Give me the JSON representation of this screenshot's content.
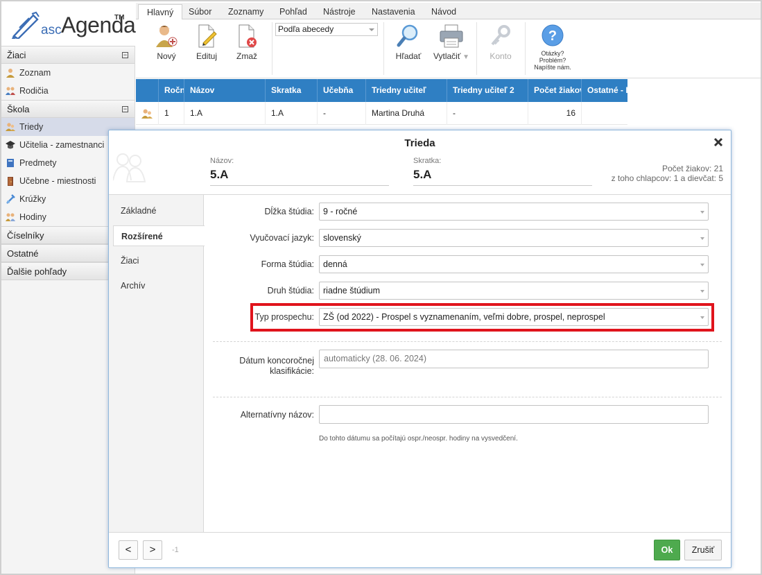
{
  "logo": {
    "asc": "asc",
    "name": "Agenda",
    "tm": "TM"
  },
  "tabs": [
    "Hlavný",
    "Súbor",
    "Zoznamy",
    "Pohľad",
    "Nástroje",
    "Nastavenia",
    "Návod"
  ],
  "ribbon": {
    "new_label": "Nový",
    "edit_label": "Edituj",
    "delete_label": "Zmaž",
    "sort_value": "Podľa abecedy",
    "find_label": "Hľadať",
    "print_label": "Vytlačiť",
    "account_label": "Konto",
    "help_line1": "Otázky?",
    "help_line2": "Problém?",
    "help_line3": "Napíšte nám."
  },
  "sidebar": {
    "sec_ziaci": "Žiaci",
    "zoznam": "Zoznam",
    "rodicia": "Rodičia",
    "sec_skola": "Škola",
    "triedy": "Triedy",
    "ucitelia": "Učitelia - zamestnanci",
    "predmety": "Predmety",
    "ucebne": "Učebne - miestnosti",
    "kruzky": "Krúžky",
    "hodiny": "Hodiny",
    "ciselniky": "Číselníky",
    "ostatne": "Ostatné",
    "dalsie": "Ďalšie pohľady",
    "toggle_symbol": "−"
  },
  "grid": {
    "headers": [
      "Ročn",
      "Názov",
      "Skratka",
      "Učebňa",
      "Triedny učiteľ",
      "Triedny učiteľ 2",
      "Počet žiakov",
      "Ostatné - I"
    ],
    "row": [
      "1",
      "1.A",
      "1.A",
      "-",
      "Martina Druhá",
      "-",
      "16",
      ""
    ]
  },
  "dialog": {
    "title": "Trieda",
    "name_label": "Názov:",
    "name_value": "5.A",
    "abbr_label": "Skratka:",
    "abbr_value": "5.A",
    "count_line1": "Počet žiakov: 21",
    "count_line2": "z toho chlapcov: 1 a dievčat: 5",
    "nav": [
      "Základné",
      "Rozšírené",
      "Žiaci",
      "Archív"
    ],
    "fields": {
      "dlzka_label": "Dĺžka štúdia:",
      "dlzka_value": "9 - ročné",
      "jazyk_label": "Vyučovací jazyk:",
      "jazyk_value": "slovenský",
      "forma_label": "Forma štúdia:",
      "forma_value": "denná",
      "druh_label": "Druh štúdia:",
      "druh_value": "riadne štúdium",
      "typ_label": "Typ prospechu:",
      "typ_value": "ZŠ (od 2022) - Prospel s vyznamenaním, veľmi dobre, prospel, neprospel",
      "datum_label_1": "Dátum koncoročnej",
      "datum_label_2": "klasifikácie:",
      "datum_placeholder": "automaticky (28. 06. 2024)",
      "datum_hint": "Do tohto dátumu sa počítajú ospr./neospr. hodiny na vysvedčení.",
      "alt_label": "Alternatívny názov:",
      "alt_value": ""
    },
    "prev_label": "<",
    "next_label": ">",
    "page_index": "-1",
    "ok_label": "Ok",
    "cancel_label": "Zrušiť"
  },
  "colors": {
    "grid_header": "#2f7fc3",
    "highlight": "#e0141c",
    "ok": "#4eaa4e",
    "sidebar_selected": "#d6dbe9"
  },
  "icons": [
    "pen-logo-icon",
    "new-user-icon",
    "edit-icon",
    "delete-icon",
    "search-icon",
    "printer-icon",
    "key-icon",
    "help-icon",
    "close-icon",
    "class-icon",
    "group-icon"
  ]
}
